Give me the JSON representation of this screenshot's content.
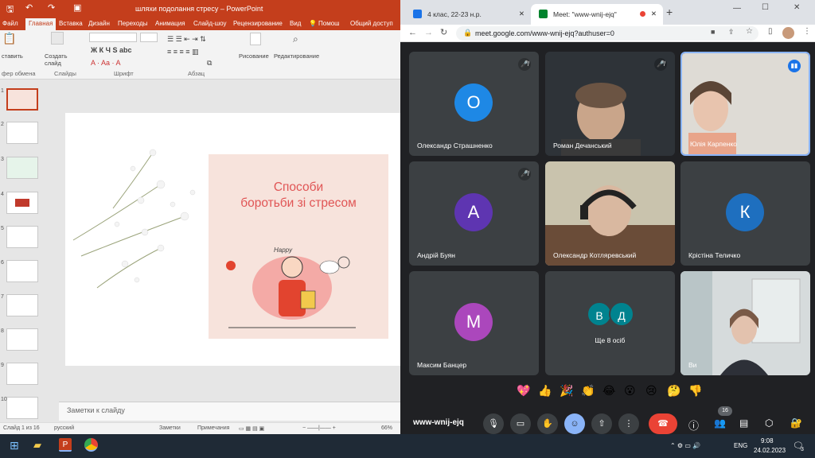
{
  "ppt": {
    "title": "шляхи подолання стресу – PowerPoint",
    "search_hint": "Помош",
    "share": "Общий доступ",
    "tabs": [
      "Файл",
      "Главная",
      "Вставка",
      "Дизайн",
      "Переходы",
      "Анимация",
      "Слайд-шоу",
      "Рецензирование",
      "Вид"
    ],
    "active_tab": "Главная",
    "ribbon": {
      "paste": "ставить",
      "new_slide_1": "Создать",
      "new_slide_2": "слайд",
      "drawing": "Рисование",
      "editing": "Редактирование",
      "groups": {
        "clipboard": "фер обмена",
        "slides": "Слайды",
        "font": "Шрифт",
        "paragraph": "Абзац"
      }
    },
    "thumb_numbers": [
      "1",
      "2",
      "3",
      "4",
      "5",
      "6",
      "7",
      "8",
      "9",
      "10"
    ],
    "slide": {
      "title_line1": "Способи",
      "title_line2": "боротьби зі стресом",
      "sticker_text": "Happy"
    },
    "notes_placeholder": "Заметки к слайду",
    "status": {
      "slide_count": "Слайд 1 из 16",
      "language": "русский",
      "notes_btn": "Заметки",
      "comments_btn": "Примечания",
      "zoom": "66%"
    }
  },
  "browser": {
    "tabs": [
      {
        "label": "4 клас, 22-23 н.р.",
        "active": false
      },
      {
        "label": "Meet: \"www-wnij-ejq\"",
        "active": true
      }
    ],
    "url": "meet.google.com/www-wnij-ejq?authuser=0",
    "colors": {
      "accent": "#1a73e8",
      "end_call": "#ea4335"
    }
  },
  "meet": {
    "participants": [
      {
        "name": "Олександр Страшненко",
        "initial": "О",
        "color": "#1e88e5",
        "muted": true
      },
      {
        "name": "Роман Дечанський",
        "initial": "",
        "color": "",
        "muted": true
      },
      {
        "name": "Юлія Карпенко",
        "initial": "",
        "color": "",
        "muted": false
      },
      {
        "name": "Андрій Буян",
        "initial": "А",
        "color": "#5e35b1",
        "muted": true
      },
      {
        "name": "Олександр Котляревський",
        "initial": "",
        "color": "",
        "muted": false
      },
      {
        "name": "Крістіна Теличко",
        "initial": "К",
        "color": "#1e6fbf",
        "muted": false
      },
      {
        "name": "Максим Банцер",
        "initial": "М",
        "color": "#ab47bc",
        "muted": false
      },
      {
        "name": "Ще 8 осіб",
        "initial": "",
        "color": "",
        "muted": false
      },
      {
        "name": "Ви",
        "initial": "",
        "color": "",
        "muted": false
      }
    ],
    "more_initials": [
      "В",
      "Д"
    ],
    "reactions": [
      "💖",
      "👍",
      "🎉",
      "👏",
      "😂",
      "😮",
      "😢",
      "🤔",
      "👎"
    ],
    "meeting_code": "www-wnij-ejq",
    "participant_count": "16"
  },
  "taskbar": {
    "language": "ENG",
    "time": "9:08",
    "date": "24.02.2023",
    "notification_count": "3"
  }
}
